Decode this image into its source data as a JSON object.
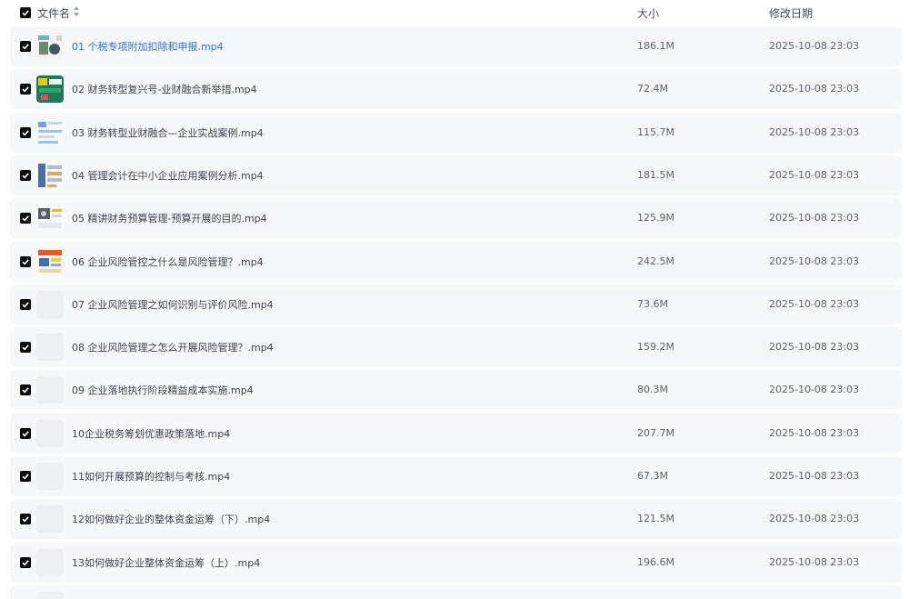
{
  "header": {
    "name_label": "文件名",
    "sort_icon": "sort-updown-icon",
    "size_label": "大小",
    "date_label": "修改日期"
  },
  "files": [
    {
      "name": "01 个税专项附加扣除和申报.mp4",
      "size": "186.1M",
      "date": "2025-10-08 23:03",
      "thumb": "video-thumbnail",
      "active": true
    },
    {
      "name": "02 财务转型复兴号-业财融合新举措.mp4",
      "size": "72.4M",
      "date": "2025-10-08 23:03",
      "thumb": "video-thumbnail"
    },
    {
      "name": "03 财务转型业财融合—企业实战案例.mp4",
      "size": "115.7M",
      "date": "2025-10-08 23:03",
      "thumb": "video-thumbnail"
    },
    {
      "name": "04 管理会计在中小企业应用案例分析.mp4",
      "size": "181.5M",
      "date": "2025-10-08 23:03",
      "thumb": "video-thumbnail"
    },
    {
      "name": "05 精讲财务预算管理-预算开展的目的.mp4",
      "size": "125.9M",
      "date": "2025-10-08 23:03",
      "thumb": "video-thumbnail"
    },
    {
      "name": "06 企业风险管控之什么是风险管理？.mp4",
      "size": "242.5M",
      "date": "2025-10-08 23:03",
      "thumb": "video-thumbnail"
    },
    {
      "name": "07 企业风险管理之如何识别与评价风险.mp4",
      "size": "73.6M",
      "date": "2025-10-08 23:03",
      "thumb": "placeholder"
    },
    {
      "name": "08 企业风险管理之怎么开展风险管理？.mp4",
      "size": "159.2M",
      "date": "2025-10-08 23:03",
      "thumb": "placeholder"
    },
    {
      "name": "09 企业落地执行阶段精益成本实施.mp4",
      "size": "80.3M",
      "date": "2025-10-08 23:03",
      "thumb": "placeholder"
    },
    {
      "name": "10企业税务筹划优惠政策落地.mp4",
      "size": "207.7M",
      "date": "2025-10-08 23:03",
      "thumb": "placeholder"
    },
    {
      "name": "11如何开展预算的控制与考核.mp4",
      "size": "67.3M",
      "date": "2025-10-08 23:03",
      "thumb": "placeholder"
    },
    {
      "name": "12如何做好企业的整体资金运筹（下）.mp4",
      "size": "121.5M",
      "date": "2025-10-08 23:03",
      "thumb": "placeholder"
    },
    {
      "name": "13如何做好企业整体资金运筹（上）.mp4",
      "size": "196.6M",
      "date": "2025-10-08 23:03",
      "thumb": "placeholder"
    },
    {
      "name": "",
      "size": "",
      "date": "",
      "thumb": "placeholder"
    }
  ],
  "colors": {
    "link": "#2f6fe0",
    "row_bg": "#f6f7f9",
    "checkbox": "#0a0a0a"
  }
}
